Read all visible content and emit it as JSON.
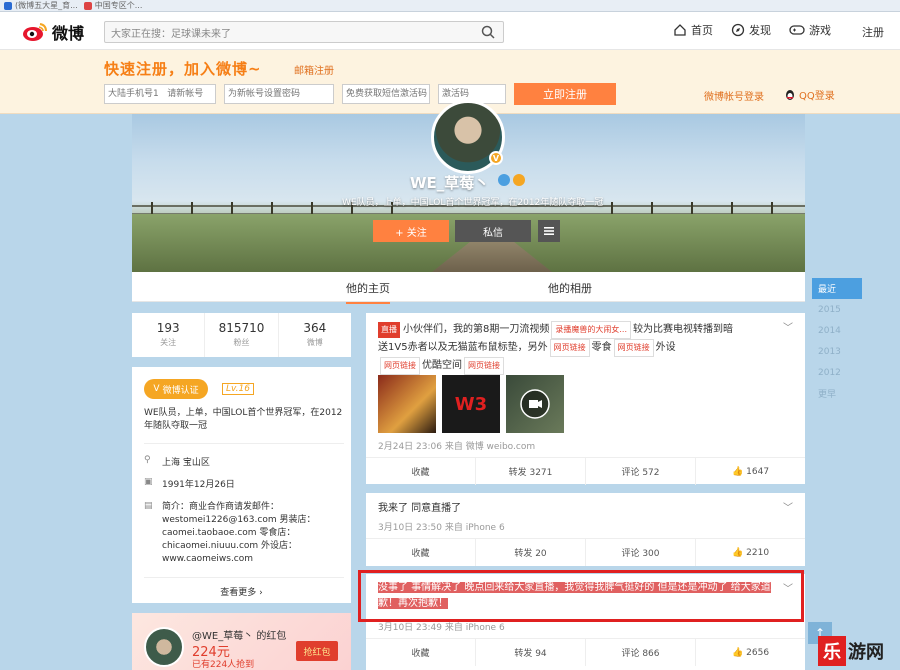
{
  "browser": {
    "tabs": [
      {
        "label": "(微博五大星_育..."
      },
      {
        "label": "中国专区个..."
      }
    ]
  },
  "topnav": {
    "brand": "微博",
    "search_placeholder": "大家正在搜：足球课未来了",
    "links": [
      {
        "label": "首页",
        "icon": "home-icon"
      },
      {
        "label": "发现",
        "icon": "compass-icon"
      },
      {
        "label": "游戏",
        "icon": "gamepad-icon"
      }
    ],
    "register": "注册"
  },
  "regbar": {
    "title": "快速注册，加入微博~",
    "mail_link": "邮箱注册",
    "phone_placeholder": "大陆手机号1   请新帐号",
    "password_placeholder": "为新帐号设置密码",
    "sms_button": "免费获取短信激活码",
    "code_placeholder": "激活码",
    "submit": "立即注册",
    "account_login": "微博帐号登录",
    "qq_login": "QQ登录"
  },
  "profile": {
    "name": "WE_草莓丶",
    "bio": "WE队员，上单，中国LOL首个世界冠军，在2012年随队夺取一冠",
    "follow": "+ 关注",
    "message": "私信",
    "more_icon": "menu-icon",
    "tabs": [
      {
        "label": "他的主页"
      },
      {
        "label": "他的相册"
      }
    ]
  },
  "years": [
    "最近",
    "2015",
    "2014",
    "2013",
    "2012",
    "更早"
  ],
  "stats": [
    {
      "num": "193",
      "label": "关注"
    },
    {
      "num": "815710",
      "label": "粉丝"
    },
    {
      "num": "364",
      "label": "微博"
    }
  ],
  "info": {
    "verified": "微博认证",
    "level": "Lv.16",
    "desc": "WE队员，上单，中国LOL首个世界冠军，在2012年随队夺取一冠",
    "location": "上海 宝山区",
    "birthday": "1991年12月26日",
    "intro": "简介：商业合作商请发邮件：westomei1226@163.com 男装店：caomei.taobaoe.com 零食店：chicaomei.niuuu.com 外设店：www.caomeiws.com",
    "see_more": "查看更多 ›"
  },
  "redpack": {
    "name": "@WE_草莓丶 的红包",
    "amount": "224元",
    "count": "已有224人抢到",
    "button": "抢红包"
  },
  "posts": [
    {
      "tag": "直播",
      "line1": "小伙伴们，我的第8期一刀流视频",
      "chip1": "录播魔兽的大闹女...",
      "line1b": "较为比赛电视转播到暗",
      "line2a": "送1V5赤者以及无猫蓝布鼠标垫，另外",
      "chip2": "网页链接",
      "line2b": "零食",
      "chip3": "网页链接",
      "line2c": "外设",
      "line3a": "网页链接",
      "line3b": "优酷空间",
      "line3c": "网页链接",
      "meta": "2月24日 23:06 来自 微博 weibo.com",
      "actions": {
        "collect": "收藏",
        "repost": "转发 3271",
        "comment": "评论 572",
        "like": "1647"
      }
    },
    {
      "text": "我来了 同意直播了",
      "meta": "3月10日 23:50 来自 iPhone 6",
      "actions": {
        "collect": "收藏",
        "repost": "转发 20",
        "comment": "评论 300",
        "like": "2210"
      }
    },
    {
      "text1": "没事了 事情解决了 晚点回来给大家直播，我觉得我脾气挺好的 但是还是冲动了 给大家道",
      "text2": "歉！再次抱歉！",
      "meta": "3月10日 23:49 来自 iPhone 6",
      "actions": {
        "collect": "收藏",
        "repost": "转发 94",
        "comment": "评论 866",
        "like": "2656"
      }
    }
  ],
  "watermark": {
    "box": "乐",
    "text": "游网"
  },
  "colors": {
    "accent": "#ff8140",
    "red": "#e03e2d",
    "blue_bg": "#b9d6ea",
    "gold": "#f5a623"
  }
}
